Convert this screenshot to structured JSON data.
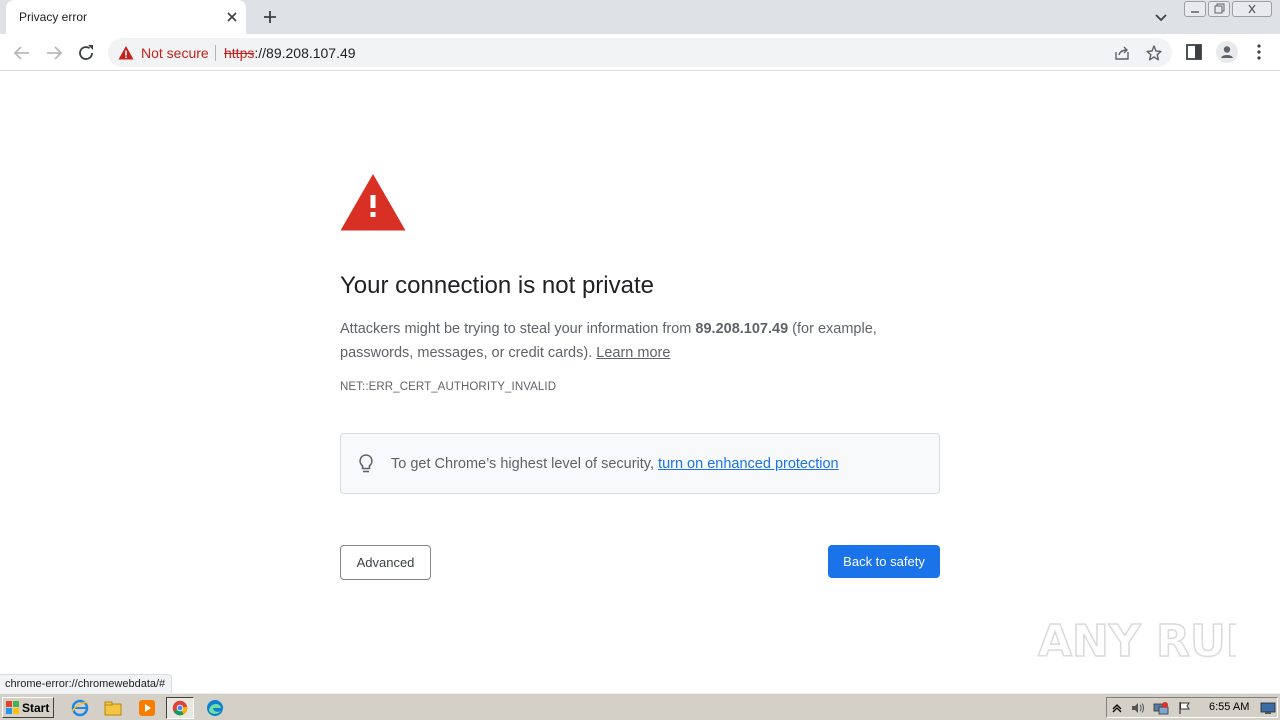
{
  "browser": {
    "tab": {
      "title": "Privacy error"
    },
    "omnibox": {
      "security_label": "Not secure",
      "url_scheme": "https",
      "url_rest": "://89.208.107.49"
    },
    "status_url": "chrome-error://chromewebdata/#"
  },
  "interstitial": {
    "heading": "Your connection is not private",
    "explanation": {
      "before_host": "Attackers might be trying to steal your information from ",
      "host": "89.208.107.49",
      "after_host": " (for example, passwords, messages, or credit cards). ",
      "learn_more": "Learn more"
    },
    "error_code": "NET::ERR_CERT_AUTHORITY_INVALID",
    "enhanced_protection": {
      "text": "To get Chrome’s highest level of security, ",
      "link": "turn on enhanced protection"
    },
    "buttons": {
      "advanced": "Advanced",
      "back_to_safety": "Back to safety"
    }
  },
  "watermark": "ANY RUN",
  "taskbar": {
    "start_label": "Start",
    "apps": [
      "ie-icon",
      "explorer-icon",
      "media-player-icon",
      "chrome-icon",
      "edge-icon"
    ],
    "clock": "6:55 AM"
  },
  "colors": {
    "accent": "#1a73e8",
    "danger": "#c5221f",
    "warning_triangle": "#d93025"
  }
}
